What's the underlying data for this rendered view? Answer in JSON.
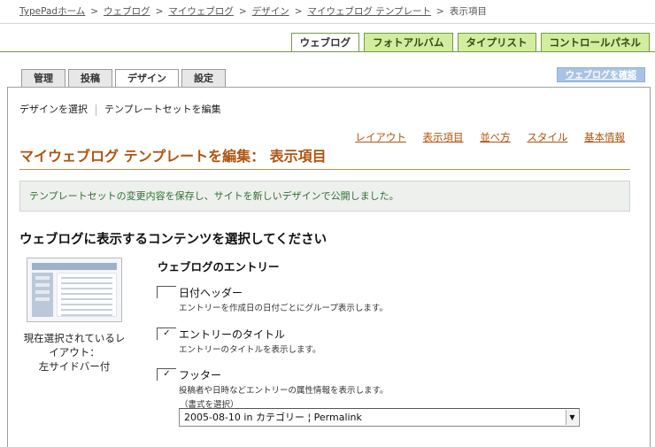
{
  "breadcrumb": {
    "items": [
      "TypePadホーム",
      "ウェブログ",
      "マイウェブログ",
      "デザイン",
      "マイウェブログ テンプレート"
    ],
    "current": "表示項目",
    "separator": ">"
  },
  "main_tabs": [
    "ウェブログ",
    "フォトアルバム",
    "タイプリスト",
    "コントロールパネル"
  ],
  "sub_tabs": [
    "管理",
    "投稿",
    "デザイン",
    "設定"
  ],
  "view_blog_button": "ウェブログを確認",
  "subnav": [
    "デザインを選択",
    "テンプレートセットを編集"
  ],
  "edit_links": [
    "レイアウト",
    "表示項目",
    "並べ方",
    "スタイル",
    "基本情報"
  ],
  "page_title": "マイウェブログ テンプレートを編集： 表示項目",
  "notice": "テンプレートセットの変更内容を保存し、サイトを新しいデザインで公開しました。",
  "section_heading": "ウェブログに表示するコンテンツを選択してください",
  "layout_caption": {
    "line1": "現在選択されているレ",
    "line2": "イアウト：",
    "line3": "左サイドバー付"
  },
  "entries_heading": "ウェブログのエントリー",
  "options": [
    {
      "label": "日付ヘッダー",
      "description": "エントリーを作成日の日付ごとにグループ表示します。",
      "checked": false
    },
    {
      "label": "エントリーのタイトル",
      "description": "エントリーのタイトルを表示します。",
      "checked": true
    },
    {
      "label": "フッター",
      "description": "投稿者や日時などエントリーの属性情報を表示します。",
      "checked": true
    }
  ],
  "check_mark": "✓",
  "format_label": "（書式を選択）",
  "format_value": "2005-08-10 in カテゴリー ¦ Permalink",
  "colors": {
    "accent": "#b0530e",
    "tab_green": "#d3ec9e",
    "tab_border": "#6f9f3f",
    "notice_text": "#2f6f2f"
  }
}
